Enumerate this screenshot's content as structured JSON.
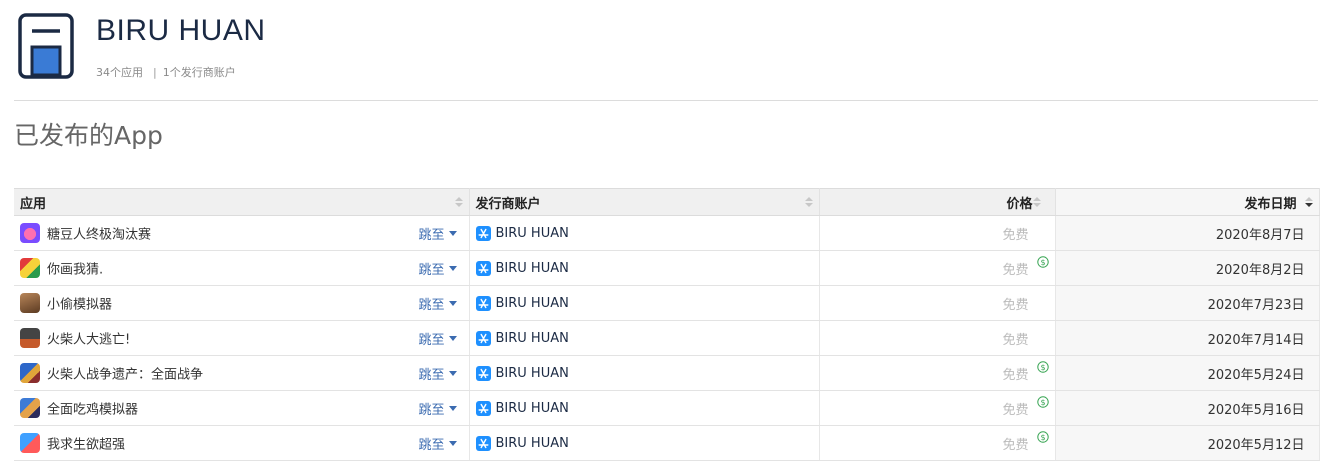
{
  "developer": {
    "name": "BIRU HUAN",
    "app_count": "34个应用",
    "separator": "|",
    "publisher_count": "1个发行商账户"
  },
  "section_title": "已发布的App",
  "table": {
    "headers": {
      "app": "应用",
      "publisher": "发行商账户",
      "price": "价格",
      "date": "发布日期"
    },
    "jump_label": "跳至",
    "rows": [
      {
        "icon": "candy-bean-app-icon",
        "name": "糖豆人终极淘汰赛",
        "publisher": "BIRU HUAN",
        "price": "免费",
        "iap": false,
        "date": "2020年8月7日"
      },
      {
        "icon": "draw-guess-app-icon",
        "name": "你画我猜.",
        "publisher": "BIRU HUAN",
        "price": "免费",
        "iap": true,
        "date": "2020年8月2日"
      },
      {
        "icon": "thief-sim-app-icon",
        "name": "小偷模拟器",
        "publisher": "BIRU HUAN",
        "price": "免费",
        "iap": false,
        "date": "2020年7月23日"
      },
      {
        "icon": "stickman-escape-app-icon",
        "name": "火柴人大逃亡!",
        "publisher": "BIRU HUAN",
        "price": "免费",
        "iap": false,
        "date": "2020年7月14日"
      },
      {
        "icon": "stickman-war-app-icon",
        "name": "火柴人战争遗产：全面战争",
        "publisher": "BIRU HUAN",
        "price": "免费",
        "iap": true,
        "date": "2020年5月24日"
      },
      {
        "icon": "chicken-sim-app-icon",
        "name": "全面吃鸡模拟器",
        "publisher": "BIRU HUAN",
        "price": "免费",
        "iap": true,
        "date": "2020年5月16日"
      },
      {
        "icon": "survival-app-icon",
        "name": "我求生欲超强",
        "publisher": "BIRU HUAN",
        "price": "免费",
        "iap": true,
        "date": "2020年5月12日"
      }
    ]
  },
  "colors": {
    "link": "#3b6bb0",
    "store_icon": "#1e90ff",
    "iap_icon": "#3aa655",
    "logo_accent": "#3a7bd5"
  }
}
